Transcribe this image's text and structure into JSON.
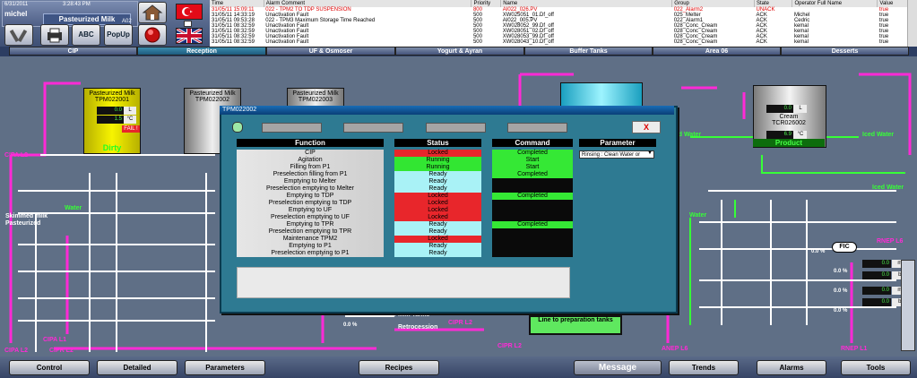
{
  "header": {
    "date": "6/31/2011",
    "time": "3:28:43 PM",
    "user": "michel",
    "product": "Pasteurized Milk",
    "product_code": "A02",
    "buttons": {
      "abc": "ABC",
      "popup": "PopUp"
    }
  },
  "alarms": {
    "columns": [
      "Time",
      "Alarm Comment",
      "Priority",
      "Name",
      "Group",
      "State",
      "Operator Full Name",
      "Value"
    ],
    "rows": [
      [
        "31/05/11 15:09:11",
        "022 - TPM2 TO TDP SUSPENSION",
        "800",
        "AI022_026.PV",
        "022_Alarm2",
        "UNACK",
        "",
        "true"
      ],
      [
        "31/05/11 14:33:19",
        "Unactivation Fault",
        "500",
        "XW025051_01.Df_off",
        "025_Melter",
        "ACK",
        "Michel",
        "true"
      ],
      [
        "31/05/11 09:53:28",
        "022 - TPM3 Maximum Storage Time Reached",
        "500",
        "AI022_005.PV",
        "022_Alarm1",
        "ACK",
        "Cedric",
        "true"
      ],
      [
        "31/05/11 08:32:59",
        "Unactivation Fault",
        "500",
        "XW028052_99.Df_off",
        "028_Conc_Cream",
        "ACK",
        "kemal",
        "true"
      ],
      [
        "31/05/11 08:32:59",
        "Unactivation Fault",
        "500",
        "XW028051_02.Df_off",
        "028_Conc_Cream",
        "ACK",
        "kemal",
        "true"
      ],
      [
        "31/05/11 08:32:59",
        "Unactivation Fault",
        "500",
        "XW028053_99.Df_off",
        "028_Conc_Cream",
        "ACK",
        "kemal",
        "true"
      ],
      [
        "31/05/11 08:32:59",
        "Unactivation Fault",
        "500",
        "XW028043_10.Df_off",
        "028_Conc_Cream",
        "ACK",
        "kemal",
        "true"
      ]
    ]
  },
  "tabs": [
    "CIP",
    "Reception",
    "UF & Osmoser",
    "Yogurt & Ayran",
    "Buffer Tanks",
    "Area 06",
    "Desserts"
  ],
  "process": {
    "tanks": [
      {
        "name": "Pasteurized Milk",
        "tag": "TPM022001",
        "status": "Dirty",
        "alarm": "FAIL !"
      },
      {
        "name": "Pasteurized Milk",
        "tag": "TPM022002"
      },
      {
        "name": "Pasteurized Milk",
        "tag": "TPM022003"
      }
    ],
    "cream_tank": {
      "name": "Cream",
      "tag": "TCR026002",
      "status": "Product"
    },
    "readings": {
      "tank1_level": "0.0",
      "tank1_temp": "1.5",
      "cream_level": "0.0",
      "cream_temp": "6.9"
    },
    "units": {
      "liter": "L",
      "celsius": "°C",
      "m3h": "m3/h",
      "bars": "bars"
    },
    "labels": {
      "cipa_l2_a": "CIPA L2",
      "cipa_l2_b": "CIPA L2",
      "cipa_l1": "CIPA L1",
      "cipr_l2_a": "CIPR L2",
      "cipr_l2_b": "CIPR L2",
      "cipr_l2_c": "CIPR L2",
      "water_a": "Water",
      "water_b": "Water",
      "skimmed": "Skimmed milk",
      "pasteurized": "Pasteurized",
      "whole_milk": "Whole Milk Tanks",
      "retrocession": "Retrocession",
      "line_prep": "Line to preparation tanks",
      "iced_water_a": "Iced Water",
      "iced_water_b": "Iced Water",
      "iced_water_c": "Iced Water",
      "rnep_l6": "RNEP L6",
      "rnep_l1": "RNEP L1",
      "anep_l6": "ANEP L6",
      "fic": "FIC",
      "pct_a": "0.0 %",
      "pct_b": "0.0 %",
      "pct_c": "0.0 %",
      "pct_d": "0.0 %",
      "pct_e": "0.0 %"
    },
    "flow_values": [
      "0.0",
      "0.0",
      "0.0",
      "0.0"
    ]
  },
  "dialog": {
    "title": "TPM022002",
    "close": "X",
    "headers": {
      "function": "Function",
      "status": "Status",
      "command": "Command",
      "parameter": "Parameter"
    },
    "parameter_value": "Rinsing : Clean Water or",
    "rows": [
      {
        "function": "CIP",
        "status": "Locked",
        "command": "Completed"
      },
      {
        "function": "Agitation",
        "status": "Running",
        "command": "Start"
      },
      {
        "function": "Filling from P1",
        "status": "Running",
        "command": "Start"
      },
      {
        "function": "Preselection filling from P1",
        "status": "Ready",
        "command": "Completed"
      },
      {
        "function": "Emptying to Melter",
        "status": "Ready",
        "command": ""
      },
      {
        "function": "Preselection emptying to Melter",
        "status": "Ready",
        "command": ""
      },
      {
        "function": "Emptying to TDP",
        "status": "Locked",
        "command": "Completed"
      },
      {
        "function": "Preselection emptying to TDP",
        "status": "Locked",
        "command": ""
      },
      {
        "function": "Emptying to UF",
        "status": "Locked",
        "command": ""
      },
      {
        "function": "Preselection emptying to UF",
        "status": "Locked",
        "command": ""
      },
      {
        "function": "Emptying to TPR",
        "status": "Ready",
        "command": "Completed"
      },
      {
        "function": "Preselection emptying to TPR",
        "status": "Ready",
        "command": ""
      },
      {
        "function": "Maintenance TPM2",
        "status": "Locked",
        "command": ""
      },
      {
        "function": "Emptying to P1",
        "status": "Ready",
        "command": ""
      },
      {
        "function": "Preselection emptying to P1",
        "status": "Ready",
        "command": ""
      }
    ]
  },
  "bottom": {
    "buttons": [
      "Control",
      "Detailed",
      "Parameters",
      "Recipes",
      "Message",
      "Trends",
      "Alarms",
      "Tools"
    ]
  },
  "colors": {
    "magenta": "#ff2ad6",
    "green": "#37ff37",
    "locked": "#e8262b",
    "running": "#32e632",
    "ready": "#a9f2f6",
    "completed": "#35e835",
    "idle_cmd": "#0a0a0a"
  }
}
